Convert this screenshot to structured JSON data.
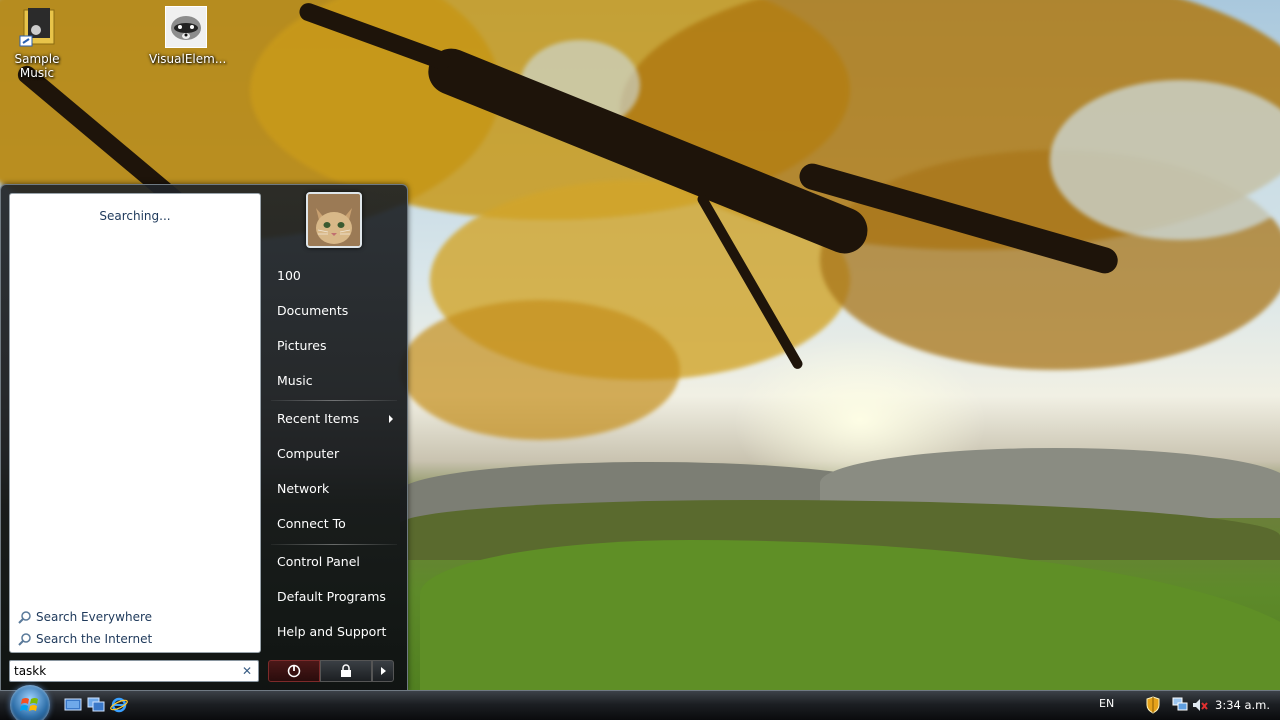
{
  "desktop": {
    "icons": [
      {
        "label": "Sample Music"
      },
      {
        "label": "VisualElem..."
      }
    ]
  },
  "start_menu": {
    "results": {
      "status_text": "Searching...",
      "search_everywhere": "Search Everywhere",
      "search_internet": "Search the Internet"
    },
    "search": {
      "value": "taskk",
      "clear_glyph": "✕"
    },
    "right_items": [
      {
        "label": "100"
      },
      {
        "label": "Documents"
      },
      {
        "label": "Pictures"
      },
      {
        "label": "Music"
      },
      {
        "label": "Recent Items"
      },
      {
        "label": "Computer"
      },
      {
        "label": "Network"
      },
      {
        "label": "Connect To"
      },
      {
        "label": "Control Panel"
      },
      {
        "label": "Default Programs"
      },
      {
        "label": "Help and Support"
      }
    ],
    "power": {
      "icons": [
        "power-icon",
        "lock-icon",
        "arrow-right-icon"
      ]
    }
  },
  "taskbar": {
    "quick_launch": [
      "show-desktop-icon",
      "switch-windows-icon",
      "internet-explorer-icon"
    ],
    "tray": {
      "language": "EN",
      "clock": "3:34 a.m.",
      "icons": [
        "security-shield-icon",
        "network-icon",
        "volume-muted-icon"
      ]
    }
  },
  "colors": {
    "menu_bg": "#1a1d20",
    "link_text": "#1e395b",
    "power_red": "#4b1818"
  }
}
